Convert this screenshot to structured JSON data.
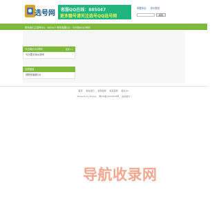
{
  "header": {
    "logo_text": "选号网",
    "banner_line1": "客服QQ在线：885047",
    "banner_line2": "更多靓号请关注选号QQ选号网",
    "links": [
      "收藏本站",
      "设为首页"
    ],
    "search_placeholder": "",
    "search_button": "搜索"
  },
  "navbar": {
    "items": [
      "联系我们之靓号QQ：885047 联系客服QQ",
      "今日特价QQ号码"
    ]
  },
  "sections": [
    {
      "title": "今日特价QQ号码",
      "more": "更多>>",
      "rows": [
        "今日暂无特价靓号"
      ]
    },
    {
      "title": "友情链接",
      "rows": [
        "请联系客服QQ"
      ]
    }
  ],
  "footer": {
    "links": [
      "首页",
      "联系我们",
      "使用说明",
      "联系客服",
      "联系QQ"
    ],
    "powered": "Powered by Emlog",
    "icp": "豫ICP备12345678号",
    "stat": "站点统计"
  },
  "watermark": "导航收录网",
  "colors": {
    "nav_green": "#7eba3b",
    "banner_green": "#1fb57c",
    "banner_yellow": "#e8f25b",
    "link_blue": "#3a6aa3",
    "watermark": "#f0a990"
  }
}
